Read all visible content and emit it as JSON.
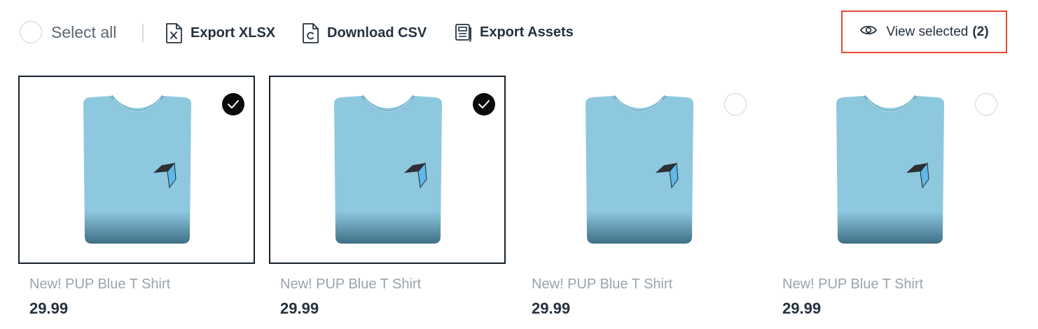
{
  "toolbar": {
    "select_all_label": "Select all",
    "export_xlsx_label": "Export XLSX",
    "download_csv_label": "Download CSV",
    "export_assets_label": "Export Assets",
    "view_selected_label": "View selected",
    "view_selected_count": "(2)"
  },
  "products": [
    {
      "name": "New! PUP Blue T Shirt",
      "price": "29.99",
      "selected": true
    },
    {
      "name": "New! PUP Blue T Shirt",
      "price": "29.99",
      "selected": true
    },
    {
      "name": "New! PUP Blue T Shirt",
      "price": "29.99",
      "selected": false
    },
    {
      "name": "New! PUP Blue T Shirt",
      "price": "29.99",
      "selected": false
    }
  ],
  "colors": {
    "highlight_border": "#e04b33",
    "selected_border": "#16202b",
    "shirt": "#8ec8df"
  },
  "icons": {
    "export_xlsx": "file-x-icon",
    "download_csv": "file-c-icon",
    "export_assets": "document-icon",
    "view_selected": "eye-icon",
    "checked": "checkmark-icon"
  }
}
